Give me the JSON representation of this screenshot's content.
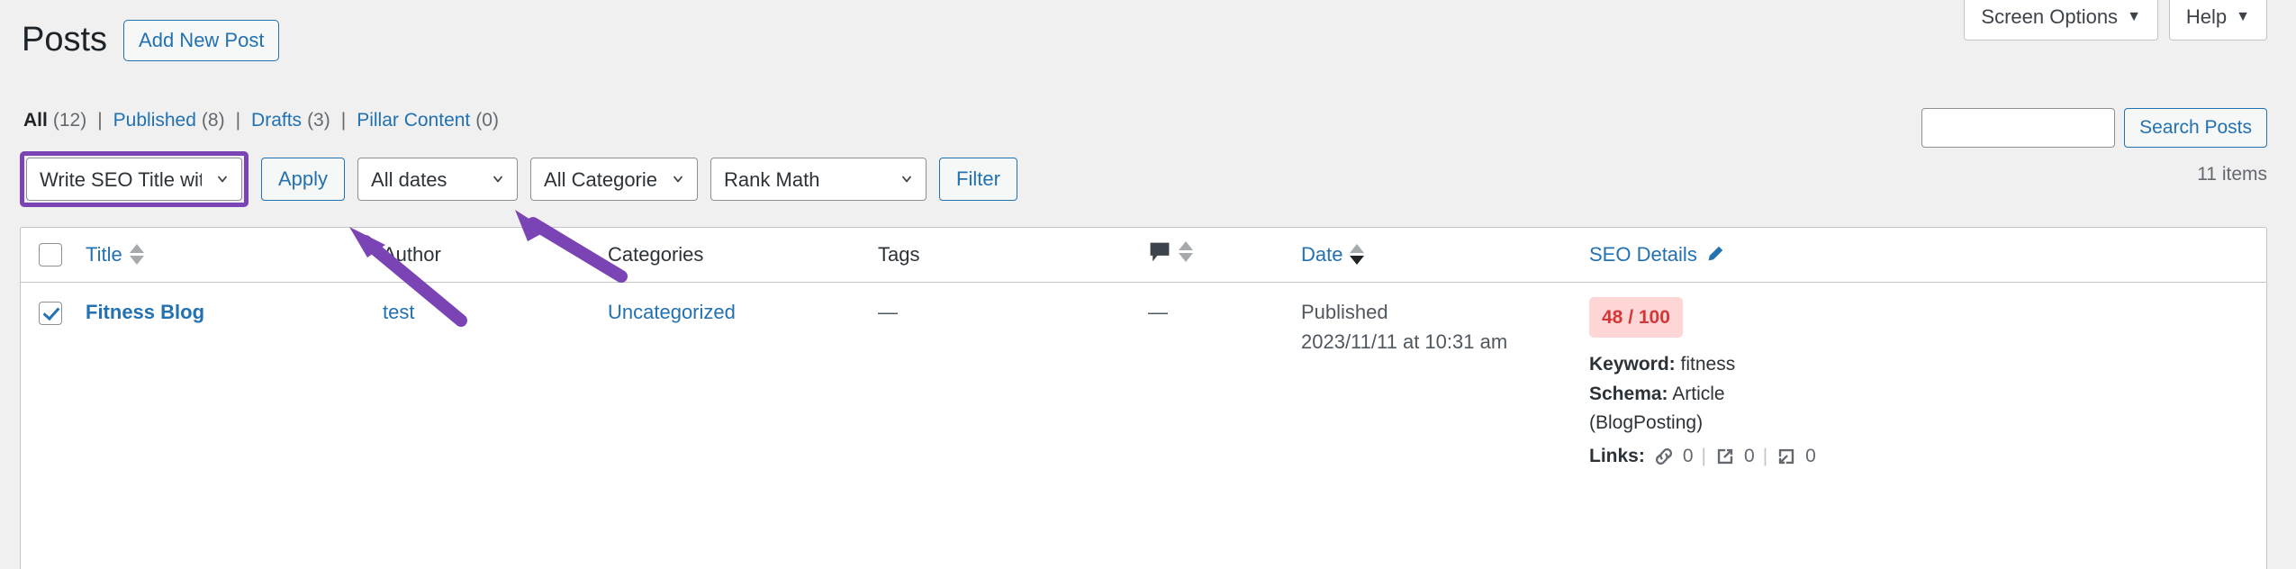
{
  "screen_meta": {
    "screen_options_label": "Screen Options",
    "help_label": "Help",
    "caret": "▼"
  },
  "header": {
    "page_title": "Posts",
    "add_new_label": "Add New Post"
  },
  "status_links": [
    {
      "label": "All",
      "count": "(12)",
      "current": true
    },
    {
      "label": "Published",
      "count": "(8)",
      "current": false
    },
    {
      "label": "Drafts",
      "count": "(3)",
      "current": false
    },
    {
      "label": "Pillar Content",
      "count": "(0)",
      "current": false
    }
  ],
  "status_separator": "|",
  "search": {
    "value": "",
    "placeholder": "",
    "submit_label": "Search Posts"
  },
  "toolbar": {
    "bulk_action_value": "Write SEO Title with AI",
    "apply_label": "Apply",
    "dates_value": "All dates",
    "categories_value": "All Categories",
    "seo_filter_value": "Rank Math",
    "filter_label": "Filter",
    "displaying_num": "11 items",
    "highlight_color": "#7b44b5"
  },
  "table": {
    "columns": {
      "title": "Title",
      "author": "Author",
      "categories": "Categories",
      "tags": "Tags",
      "comments_icon": "comment-bubble-icon",
      "date": "Date",
      "seo_details": "SEO Details",
      "seo_edit_icon": "pencil-icon"
    },
    "rows": [
      {
        "selected": true,
        "title": "Fitness Blog",
        "author": "test",
        "categories": "Uncategorized",
        "tags": "—",
        "comments": "—",
        "date_status": "Published",
        "date_value": "2023/11/11 at 10:31 am",
        "seo": {
          "score": "48 / 100",
          "keyword_label": "Keyword:",
          "keyword_value": "fitness",
          "schema_label": "Schema:",
          "schema_value": "Article",
          "schema_value2": "(BlogPosting)",
          "links_label": "Links:",
          "internal_links": "0",
          "external_links": "0",
          "incoming_links": "0",
          "link_divider": "|"
        }
      }
    ]
  },
  "annotations": {
    "arrow_color": "#7b44b5",
    "arrow_1_target": "bulk-action-select",
    "arrow_2_target": "apply-button"
  }
}
